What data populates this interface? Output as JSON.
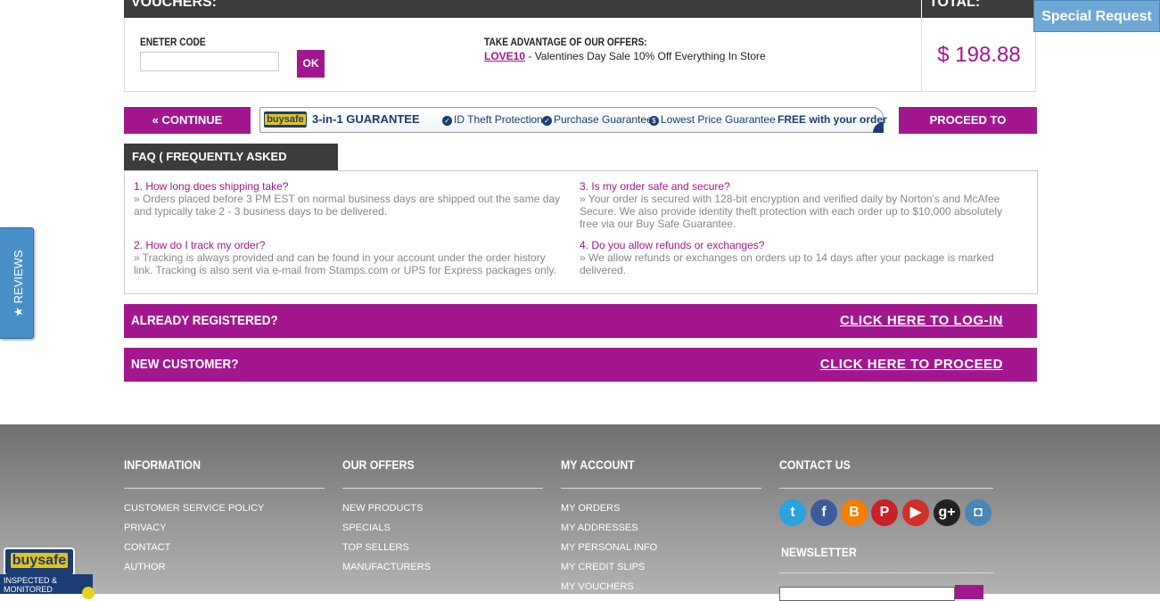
{
  "vouchers": {
    "header": "VOUCHERS:",
    "code_label": "ENETER CODE",
    "code_value": "",
    "ok_label": "OK",
    "offers_label": "TAKE ADVANTAGE OF OUR OFFERS:",
    "offer_code": "LOVE10",
    "offer_text": " - Valentines Day Sale 10% Off Everything In Store"
  },
  "total": {
    "header": "TOTAL:",
    "value": "$ 198.88"
  },
  "actions": {
    "continue_label": "« CONTINUE SHOPPING",
    "checkout_label": "PROCEED TO CHECKOUT »"
  },
  "guarantee": {
    "badge": "buysafe",
    "title": "3-in-1 GUARANTEE",
    "items": [
      "ID Theft Protection",
      "Purchase Guarantee",
      "Lowest Price Guarantee"
    ],
    "free": "FREE with your order"
  },
  "faq": {
    "tab_label": "FAQ ( FREQUENTLY ASKED QUESTIONS ) »",
    "items": [
      {
        "q": "1. How long does shipping take?",
        "a": "» Orders placed before 3 PM EST on normal business days are shipped out the same day and typically take 2 - 3 business days to be delivered."
      },
      {
        "q": "3. Is my order safe and secure?",
        "a": "» Your order is secured with 128-bit encryption and verified daily by Norton's and McAfee Secure. We also provide identity theft protection with each order up to $10,000 absolutely free via our Buy Safe Guarantee."
      },
      {
        "q": "2. How do I track my order?",
        "a": "» Tracking is always provided and can be found in your account under the order history link. Tracking is also sent via e-mail from Stamps.com or UPS for Express packages only."
      },
      {
        "q": "4. Do you allow refunds or exchanges?",
        "a": "» We allow refunds or exchanges on orders up to 14 days after your package is marked delivered."
      }
    ]
  },
  "registered": {
    "title": "ALREADY REGISTERED?",
    "link": "CLICK HERE TO LOG-IN"
  },
  "new_customer": {
    "title": "NEW CUSTOMER?",
    "link": "CLICK HERE TO PROCEED"
  },
  "reviews_tab": "★ REVIEWS",
  "special_request": "Special Request",
  "footer": {
    "information": {
      "title": "INFORMATION",
      "links": [
        "CUSTOMER SERVICE POLICY",
        "PRIVACY",
        "CONTACT",
        "AUTHOR"
      ]
    },
    "offers": {
      "title": "OUR OFFERS",
      "links": [
        "NEW PRODUCTS",
        "SPECIALS",
        "TOP SELLERS",
        "MANUFACTURERS"
      ]
    },
    "account": {
      "title": "MY ACCOUNT",
      "links": [
        "MY ORDERS",
        "MY ADDRESSES",
        "MY PERSONAL INFO",
        "MY CREDIT SLIPS",
        "MY VOUCHERS"
      ]
    },
    "contact": {
      "title": "CONTACT US",
      "social": [
        {
          "name": "twitter-icon",
          "glyph": "t",
          "color": "#2aa3de"
        },
        {
          "name": "facebook-icon",
          "glyph": "f",
          "color": "#3b5b9a"
        },
        {
          "name": "blogger-icon",
          "glyph": "B",
          "color": "#f57d00"
        },
        {
          "name": "pinterest-icon",
          "glyph": "P",
          "color": "#cb2027"
        },
        {
          "name": "youtube-icon",
          "glyph": "▶",
          "color": "#d0302a"
        },
        {
          "name": "googleplus-icon",
          "glyph": "g+",
          "color": "#222222"
        },
        {
          "name": "instagram-icon",
          "glyph": "◘",
          "color": "#4a87b5"
        }
      ],
      "newsletter_title": "NEWSLETTER"
    }
  },
  "seal": {
    "brand": "buysafe",
    "caption": "INSPECTED & MONITORED"
  },
  "colors": {
    "accent": "#a3178e",
    "dark": "#3c3c3c",
    "reviews": "#4a90c8"
  }
}
